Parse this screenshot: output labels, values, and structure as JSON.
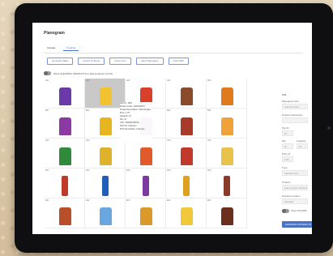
{
  "app": {
    "title": "Planogram"
  },
  "tabs": [
    {
      "label": "Canvas"
    },
    {
      "label": "Pending"
    }
  ],
  "toolbar": {
    "buttons": [
      "Generate Table",
      "Import To Excel",
      "Copy From",
      "View Planogram",
      "Print PDF"
    ]
  },
  "banner": {
    "text": "Show SHOWING PRODUCTS to add products to POG"
  },
  "grid": {
    "labels": [
      [
        "A01",
        "A02",
        "A03",
        "A04",
        "A05"
      ],
      [
        "B01",
        "B02",
        "B03",
        "B04",
        "B05"
      ],
      [
        "C01",
        "C02",
        "C03",
        "C04",
        "C05"
      ],
      [
        "D01",
        "D02",
        "D03",
        "D04",
        "D05"
      ],
      [
        "E01",
        "E02",
        "E03",
        "E04",
        "E05"
      ]
    ],
    "product_colors": [
      [
        "#6b3aa8",
        "#f2c230",
        "#d9402b",
        "#8a4b2a",
        "#e07a1f"
      ],
      [
        "#8b3aa3",
        "#e7b61e",
        "#7a2b8f",
        "#a83a2a",
        "#f0a23a"
      ],
      [
        "#2f8a3a",
        "#e0b12a",
        "#e05a2a",
        "#c0392b",
        "#e8c24a"
      ],
      [
        "#c0392b",
        "#1f5fb8",
        "#7b3aa0",
        "#e0a020",
        "#8a3b2a"
      ],
      [
        "#b84f2a",
        "#6aa7e0",
        "#d99a2a",
        "#f0c83a",
        "#6b2f1f"
      ]
    ]
  },
  "tooltip": {
    "lines": [
      "Item ID: 1851",
      "Product Code: 2000032972",
      "Product Description: SNS Pringles",
      "Price: 1.75",
      "Capacity: 10",
      "Par: 12",
      "UPC: 038000138799",
      "POG ID: Unknown",
      "POG Description: Unknown"
    ]
  },
  "panel": {
    "header": "A01",
    "fields": [
      {
        "label": "Planogram Item",
        "value": "Select Product"
      },
      {
        "label": "Product description",
        "value": ""
      },
      {
        "label": "Par ID",
        "value": "10"
      },
      {
        "label": "Min",
        "value": "10"
      },
      {
        "label": "Capacity",
        "value": "16"
      },
      {
        "label": "Price Id",
        "value": "1.96"
      },
      {
        "label": "Type",
        "value": "Standard Coil"
      },
      {
        "label": "Product",
        "value": "Enter Custom Product"
      },
      {
        "label": "Product Location",
        "value": "Standard"
      }
    ],
    "button": "SHOWING PRODUCTS"
  }
}
